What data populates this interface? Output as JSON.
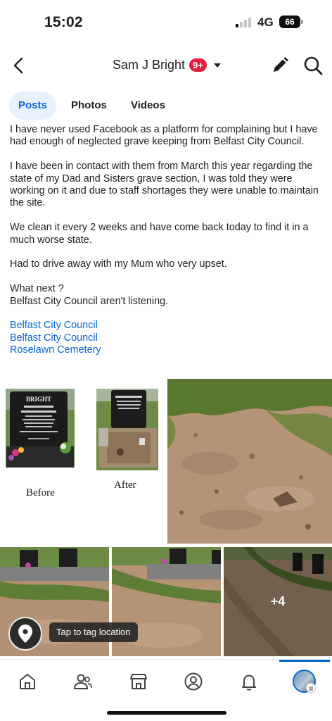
{
  "status_bar": {
    "time": "15:02",
    "network": "4G",
    "battery": "66"
  },
  "header": {
    "name": "Sam J Bright",
    "badge": "9+"
  },
  "tabs": [
    {
      "label": "Posts",
      "active": true
    },
    {
      "label": "Photos",
      "active": false
    },
    {
      "label": "Videos",
      "active": false
    }
  ],
  "post": {
    "paragraphs": [
      "I have never used Facebook as a platform for complaining but I have had enough of neglected grave keeping from Belfast City Council.",
      "I have been in contact with them from March this year regarding the state of my Dad and Sisters grave section, I was told they were working on it and due to staff shortages they were unable to maintain the site.",
      "We clean it every 2 weeks and have come back today to find it in a much worse state.",
      "Had to drive away with my Mum who very upset.",
      "What next ?",
      "Belfast City Council aren't listening."
    ],
    "tags": [
      "Belfast City Council",
      "Belfast City Council",
      "Roselawn Cemetery"
    ]
  },
  "photos": {
    "before_caption": "Before",
    "after_caption": "After",
    "headstone_name": "BRIGHT",
    "more_count": "+4"
  },
  "tag_location": "Tap to tag location",
  "colors": {
    "accent": "#0866d1",
    "badge": "#e41e3f",
    "tab_active_bg": "#e7f0fd"
  },
  "nav": {
    "items": [
      "home-icon",
      "friends-icon",
      "marketplace-icon",
      "profile-icon",
      "notifications-icon",
      "menu-avatar"
    ]
  }
}
